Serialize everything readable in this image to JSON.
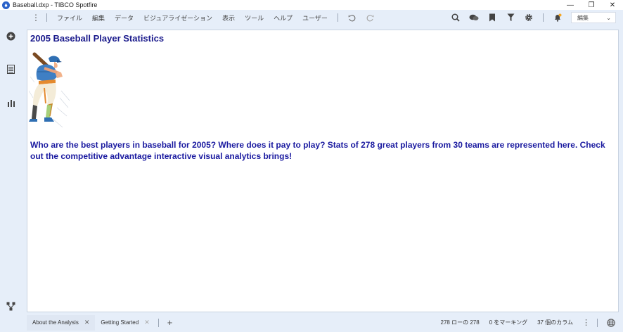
{
  "window": {
    "title": "Baseball.dxp - TIBCO Spotfire",
    "minimize_glyph": "—",
    "restore_glyph": "❐",
    "close_glyph": "✕"
  },
  "toolbar": {
    "more_glyph": "⋮",
    "menu": [
      "ファイル",
      "編集",
      "データ",
      "ビジュアライゼーション",
      "表示",
      "ツール",
      "ヘルプ",
      "ユーザー"
    ],
    "icons": [
      "undo-icon",
      "redo-icon",
      "search-icon",
      "collaboration-icon",
      "bookmark-icon",
      "filter-icon",
      "settings-icon",
      "notifications-icon"
    ],
    "mode_value": "編集",
    "mode_chevron": "⌄"
  },
  "sidebar": {
    "icons": [
      "add-data-icon",
      "data-table-icon",
      "visualization-icon",
      "data-canvas-icon"
    ]
  },
  "page": {
    "title": "2005 Baseball Player Statistics",
    "description": "Who are the best players in baseball for 2005? Where does it pay to play? Stats of 278 great players from 30 teams are represented here. Check out the competitive advantage interactive visual analytics brings!"
  },
  "tabs": [
    {
      "label": "About the Analysis",
      "active": true
    },
    {
      "label": "Getting Started",
      "active": false
    }
  ],
  "tab_close_glyph": "✕",
  "add_tab_glyph": "+",
  "status": {
    "rows": "278 ローの 278",
    "marked": "0 をマーキング",
    "columns": "37 個のカラム",
    "more_glyph": "⋮"
  },
  "colors": {
    "chrome": "#e6eef9",
    "heading": "#1a1a8c",
    "accent": "#2b62c9"
  }
}
